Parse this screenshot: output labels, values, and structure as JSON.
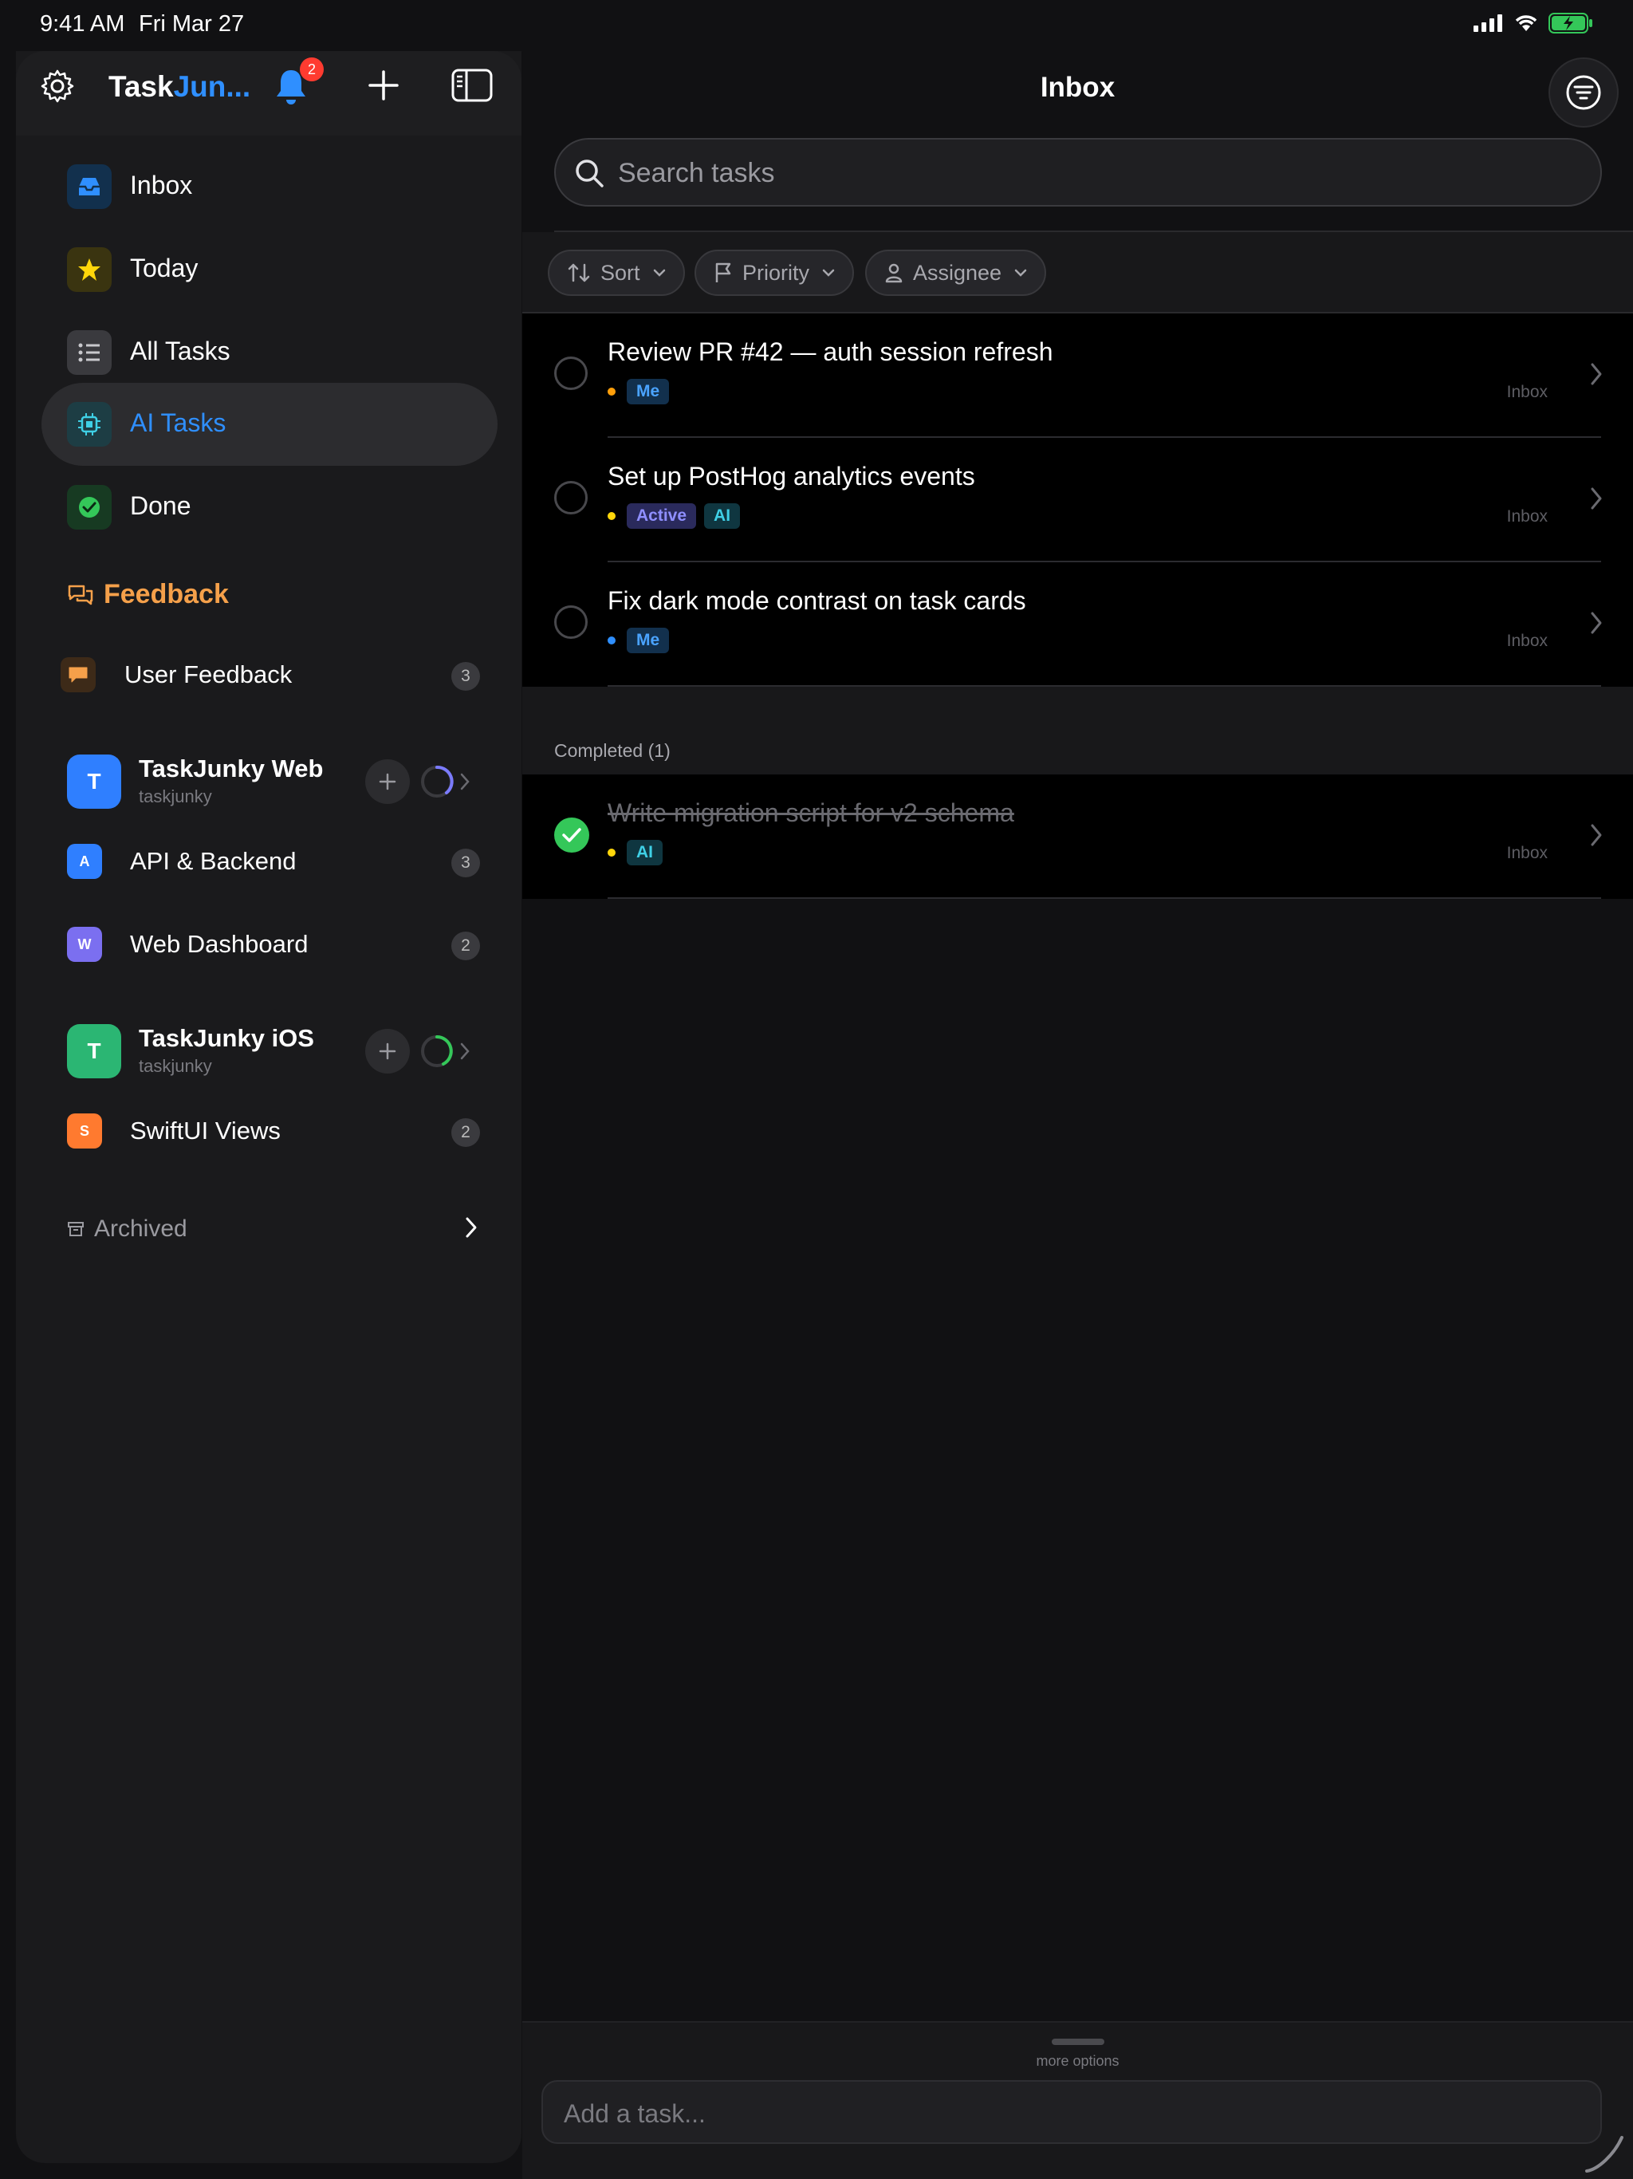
{
  "status_bar": {
    "time": "9:41 AM",
    "date": "Fri Mar 27"
  },
  "sidebar": {
    "app_name_part1": "Task",
    "app_name_part2": "Jun...",
    "notification_count": "2",
    "nav": [
      {
        "label": "Inbox",
        "icon": "inbox-icon",
        "color": "#2f8fff"
      },
      {
        "label": "Today",
        "icon": "star-icon",
        "color": "#ffd60a"
      },
      {
        "label": "All Tasks",
        "icon": "list-icon",
        "color": "#c8c8cc"
      },
      {
        "label": "AI Tasks",
        "icon": "chip-icon",
        "color": "#3fd0e6",
        "selected": true
      },
      {
        "label": "Done",
        "icon": "checkmark-circle-icon",
        "color": "#34c759"
      }
    ],
    "feedback": {
      "heading": "Feedback",
      "item_label": "User Feedback",
      "item_count": "3"
    },
    "projects": [
      {
        "name": "TaskJunky Web",
        "slug": "taskjunky",
        "avatar": "T",
        "color": "#2f7fff",
        "subprojects": [
          {
            "letter": "A",
            "label": "API & Backend",
            "count": "3",
            "color": "#2f7fff"
          },
          {
            "letter": "W",
            "label": "Web Dashboard",
            "count": "2",
            "color": "#7b6ff0"
          }
        ]
      },
      {
        "name": "TaskJunky iOS",
        "slug": "taskjunky",
        "avatar": "T",
        "color": "#2bb673",
        "subprojects": [
          {
            "letter": "S",
            "label": "SwiftUI Views",
            "count": "2",
            "color": "#ff7a2f"
          }
        ]
      }
    ],
    "archived_label": "Archived"
  },
  "main": {
    "title": "Inbox",
    "search_placeholder": "Search tasks",
    "chips": {
      "sort": "Sort",
      "priority": "Priority",
      "assignee": "Assignee"
    },
    "tasks": [
      {
        "title": "Review PR #42 — auth session refresh",
        "dot_color": "#ff9f0a",
        "tags": [
          "Me"
        ],
        "location": "Inbox"
      },
      {
        "title": "Set up PostHog analytics events",
        "dot_color": "#ffd60a",
        "tags": [
          "Active",
          "AI"
        ],
        "location": "Inbox"
      },
      {
        "title": "Fix dark mode contrast on task cards",
        "dot_color": "#2f8fff",
        "tags": [
          "Me"
        ],
        "location": "Inbox"
      }
    ],
    "completed_label": "Completed (1)",
    "completed_tasks": [
      {
        "title": "Write migration script for v2 schema",
        "dot_color": "#ffd60a",
        "tags": [
          "AI"
        ],
        "location": "Inbox"
      }
    ],
    "more_options": "more options",
    "add_task_placeholder": "Add a task..."
  }
}
